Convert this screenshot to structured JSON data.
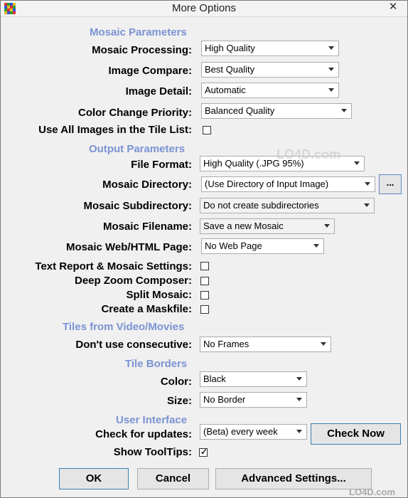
{
  "window": {
    "title": "More Options",
    "close_glyph": "✕"
  },
  "mosaic": {
    "section": "Mosaic Parameters",
    "processing": {
      "label": "Mosaic Processing:",
      "value": "High Quality"
    },
    "compare": {
      "label": "Image Compare:",
      "value": "Best Quality"
    },
    "detail": {
      "label": "Image Detail:",
      "value": "Automatic"
    },
    "priority": {
      "label": "Color Change Priority:",
      "value": "Balanced Quality"
    },
    "use_all": {
      "label": "Use All Images in the Tile List:",
      "checked": false
    }
  },
  "output": {
    "section": "Output Parameters",
    "format": {
      "label": "File Format:",
      "value": "High Quality (.JPG 95%)"
    },
    "directory": {
      "label": "Mosaic Directory:",
      "value": "(Use Directory of Input Image)",
      "browse": "..."
    },
    "subdirectory": {
      "label": "Mosaic Subdirectory:",
      "value": "Do not create subdirectories"
    },
    "filename": {
      "label": "Mosaic Filename:",
      "value": "Save a new Mosaic"
    },
    "webpage": {
      "label": "Mosaic Web/HTML Page:",
      "value": "No Web Page"
    },
    "text_report": {
      "label": "Text Report & Mosaic Settings:",
      "checked": false
    },
    "deep_zoom": {
      "label": "Deep Zoom Composer:",
      "checked": false
    },
    "split": {
      "label": "Split Mosaic:",
      "checked": false
    },
    "maskfile": {
      "label": "Create a Maskfile:",
      "checked": false
    }
  },
  "video": {
    "section": "Tiles from Video/Movies",
    "consecutive": {
      "label": "Don't use consecutive:",
      "value": "No Frames"
    }
  },
  "borders": {
    "section": "Tile Borders",
    "color": {
      "label": "Color:",
      "value": "Black"
    },
    "size": {
      "label": "Size:",
      "value": "No Border"
    }
  },
  "ui": {
    "section": "User Interface",
    "updates": {
      "label": "Check for updates:",
      "value": "(Beta) every week",
      "check_now": "Check Now"
    },
    "tooltips": {
      "label": "Show ToolTips:",
      "checked": true,
      "glyph": "✓"
    }
  },
  "footer": {
    "ok": "OK",
    "cancel": "Cancel",
    "advanced": "Advanced Settings..."
  },
  "watermark": {
    "text": "LO4D.com"
  },
  "colors": {
    "section": "#7b93d3",
    "primary_border": "#3c7fb1"
  }
}
